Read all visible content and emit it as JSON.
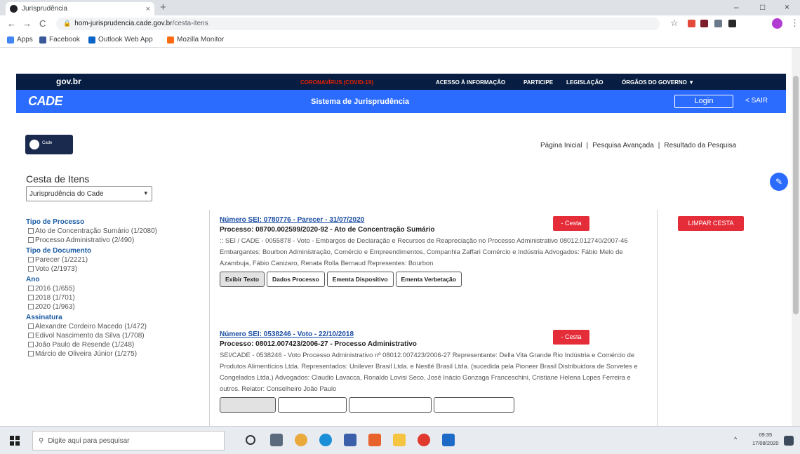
{
  "browser": {
    "tab_title": "Jurisprudência",
    "tab_close": "×",
    "new_tab": "+",
    "win_min": "–",
    "win_max": "□",
    "win_close": "×",
    "back": "←",
    "forward": "→",
    "reload": "C",
    "url_host": "hom-jurisprudencia.cade.gov.br",
    "url_path": "/cesta-itens",
    "star": "☆",
    "menu": "⋮",
    "bookmarks": [
      "Apps",
      "Facebook",
      "Outlook Web App",
      "Mozilla Monitor"
    ]
  },
  "gov": {
    "logo": "gov.br",
    "covid": "CORONAVÍRUS (COVID-19)",
    "links": [
      "ACESSO À INFORMAÇÃO",
      "PARTICIPE",
      "LEGISLAÇÃO",
      "ÓRGÃOS DO GOVERNO ▼"
    ]
  },
  "cade": {
    "logo": "CADE",
    "title": "Sistema de Jurisprudência",
    "login": "Login",
    "sair": "< SAIR"
  },
  "site_logo_text": "Cade",
  "topnav": [
    "Página Inicial",
    "Pesquisa Avançada",
    "Resultado da Pesquisa"
  ],
  "topnav_sep": "|",
  "cesta": {
    "title": "Cesta de Itens",
    "select_value": "Jurisprudência do Cade",
    "select_chevron": "▾"
  },
  "facets": [
    {
      "head": "Tipo de Processo",
      "items": [
        "Ato de Concentração Sumário (1/2080)",
        "Processo Administrativo (2/490)"
      ]
    },
    {
      "head": "Tipo de Documento",
      "items": [
        "Parecer (1/2221)",
        "Voto (2/1973)"
      ]
    },
    {
      "head": "Ano",
      "items": [
        "2016 (1/655)",
        "2018 (1/701)",
        "2020 (1/963)"
      ]
    },
    {
      "head": "Assinatura",
      "items": [
        "Alexandre Cordeiro Macedo (1/472)",
        "Edivol Nascimento da Silva (1/708)",
        "João Paulo de Resende (1/248)",
        "Márcio de Oliveira Júnior (1/275)"
      ]
    }
  ],
  "results": [
    {
      "link": "Número SEI: 0780776 - Parecer - 31/07/2020",
      "processo": "Processo: 08700.002599/2020-92 - Ato de Concentração Sumário",
      "body": ":: SEI / CADE - 0055878 - Voto - Embargos de Declaração e Recursos de Reapreciação no Processo Administrativo 08012.012740/2007-46 Embargantes: Bourbon Administração, Comércio e Empreendimentos, Companhia Zaffari Comércio e Indústria Advogados: Fábio Melo de Azambuja, Fábio Canizaro, Renata Rolla Bernaud Representes: Bourbon",
      "buttons": [
        "Exibir Texto",
        "Dados Processo",
        "Ementa Dispositivo",
        "Ementa Verbetação"
      ],
      "remove": "- Cesta"
    },
    {
      "link": "Número SEI: 0538246 - Voto - 22/10/2018",
      "processo": "Processo: 08012.007423/2006-27 - Processo Administrativo",
      "body": "SEI/CADE - 0538246 - Voto Processo Administrativo nº 08012.007423/2006-27 Representante: Della Vita Grande Rio Indústria e Comércio de Produtos Alimentícios Ltda. Representados: Unilever Brasil Ltda. e Nestlé Brasil Ltda. (sucedida pela Pioneer Brasil Distribuidora de Sorvetes e Congelados Ltda.) Advogados: Claudio Lavacca, Ronaldo Lovisi Seco, José Inácio Gonzaga Franceschini, Cristiane Helena Lopes Ferreira e outros. Relator: Conselheiro João Paulo",
      "buttons": [
        "",
        "",
        "",
        ""
      ],
      "remove": "- Cesta"
    }
  ],
  "limpar": "LIMPAR CESTA",
  "help_icon": "✎",
  "taskbar": {
    "search_placeholder": "Digite aqui para pesquisar",
    "search_icon": "⚲",
    "tray_arrow": "^",
    "time": "09:35",
    "date": "17/08/2020"
  }
}
